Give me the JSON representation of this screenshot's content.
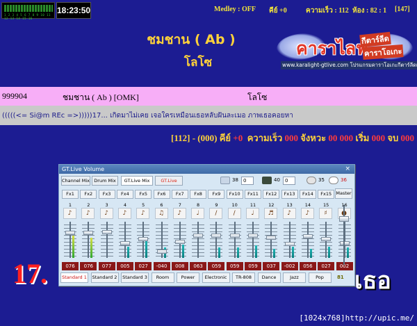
{
  "meter": {
    "numbers": "1 2 3 4 5 6 7 8 9 10 11 12 13 14 15 16"
  },
  "clock": "18:23:50",
  "status": {
    "medley": "Medley : OFF",
    "key": "คีย์ +0",
    "speed": "ความเร็ว : 112",
    "room": "ห้อง : 82 : 1",
    "count": "[147]"
  },
  "song": {
    "title": "ชมชาน ( Ab )",
    "singer": "โลโซ"
  },
  "logo": {
    "brand": "คาราไลฟ์",
    "tag1": "กีตาร์ลีด",
    "tag2": "คาราโอเกะ",
    "url": "www.karalight-gtlive.com โปรแกรมคาราโอเกะกีตาร์ลีดเสมือน"
  },
  "pinkrow": {
    "code": "999904",
    "song": "ชมชาน ( Ab ) [OMK]",
    "artist": "โลโซ"
  },
  "ticker": "(((((<= Si@m REc =>)))))17... เกิดมาไม่เคย เจอใครเหมือนเธอหลับฝันละเมอ ภาพเธอคอยหา",
  "infoline": {
    "prefix": "[112] - (000)",
    "key_label": "คีย์",
    "key_val": "+0",
    "speed_label": "ความเร็ว",
    "speed_val": "000",
    "beat_label": "จังหวะ",
    "beat_val": "00 000",
    "start_label": "เริ่ม",
    "start_val": "000",
    "end_label": "จบ",
    "end_val": "000"
  },
  "lyric": {
    "number": "17.",
    "text": "เธอ"
  },
  "window": {
    "title": "GT.Live Volume",
    "close": "×",
    "tabs": [
      "Channel Mix",
      "Drum Mix",
      "GT.Live Mix",
      "GT.Live"
    ],
    "controls": {
      "v1": "38",
      "s1": "0",
      "v2": "40",
      "s2": "0",
      "v3": "35",
      "v4": "36"
    },
    "fx": [
      "Fx1",
      "Fx2",
      "Fx3",
      "Fx4",
      "Fx5",
      "Fx6",
      "Fx7",
      "Fx8",
      "Fx9",
      "Fx10",
      "Fx11",
      "Fx12",
      "Fx13",
      "Fx14",
      "Fx15"
    ],
    "master_label": "Master",
    "channels": [
      "1",
      "2",
      "3",
      "4",
      "5",
      "6",
      "7",
      "8",
      "9",
      "10",
      "11",
      "12",
      "13",
      "14",
      "15",
      "16"
    ],
    "instruments": [
      "guitar-icon",
      "guitar-icon",
      "guitar-icon",
      "guitar-icon",
      "guitar-icon",
      "violin-icon",
      "guitar-icon",
      "sax-icon",
      "flute-icon",
      "flute-icon",
      "sax-icon",
      "horn-icon",
      "guitar-icon",
      "guitar-icon",
      "strings-icon",
      "drum-icon"
    ],
    "values": [
      "076",
      "076",
      "077",
      "005",
      "027",
      "-040",
      "008",
      "063",
      "059",
      "059",
      "059",
      "037",
      "-002",
      "056",
      "027",
      "002"
    ],
    "levels": [
      0.62,
      0.55,
      0.0,
      0.3,
      0.5,
      0.28,
      0.36,
      0.0,
      0.28,
      0.28,
      0.35,
      0.25,
      0.3,
      0.25,
      0.3,
      0.28
    ],
    "faders": [
      0.72,
      0.72,
      0.73,
      0.4,
      0.52,
      0.12,
      0.44,
      0.64,
      0.62,
      0.62,
      0.62,
      0.56,
      0.38,
      0.6,
      0.52,
      0.4
    ],
    "master_value": 0.8,
    "presets": [
      "Standard 1",
      "Standard 2",
      "Standard 3",
      "Room",
      "Power",
      "Electronic",
      "TR-808",
      "Dance",
      "Jazz",
      "Pop"
    ],
    "master_readout": "81"
  },
  "footer": "[1024x768]http://upic.me/"
}
